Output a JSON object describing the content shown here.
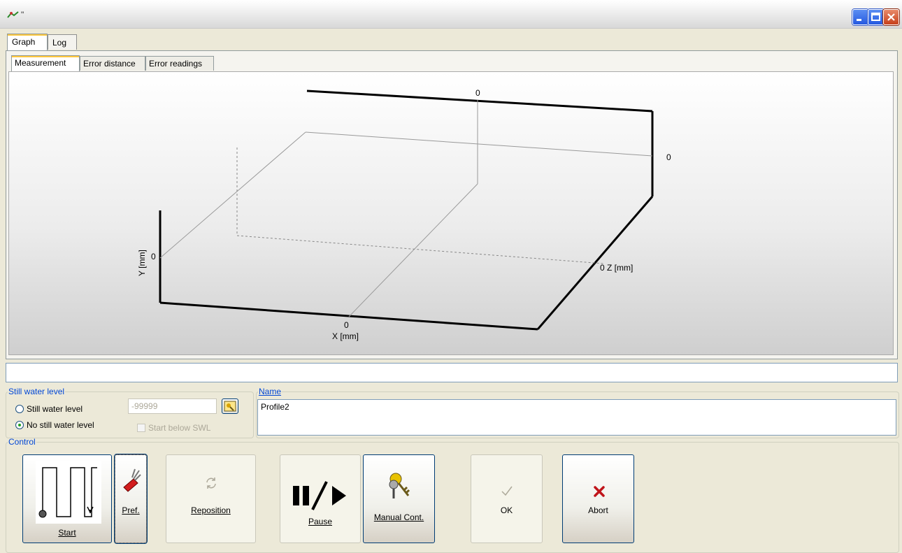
{
  "window": {
    "title": "\""
  },
  "outer_tabs": [
    "Graph",
    "Log"
  ],
  "inner_tabs": [
    "Measurement",
    "Error distance",
    "Error readings"
  ],
  "graph": {
    "x_label": "X [mm]",
    "y_label": "Y [mm]",
    "z_label": "Z [mm]",
    "x_tick": "0",
    "y_tick": "0",
    "z_tick": "0",
    "top_tick": "0",
    "right_tick": "0"
  },
  "still_water": {
    "legend": "Still water level",
    "option1": "Still water level",
    "option2": "No still water level",
    "selected": "No still water level",
    "value": "-99999",
    "checkbox_label": "Start below SWL"
  },
  "name": {
    "legend": "Name",
    "value": "Profile2"
  },
  "control": {
    "legend": "Control",
    "start": "Start",
    "pref": "Pref.",
    "reposition": "Reposition",
    "pause": "Pause",
    "manual": "Manual Cont.",
    "ok": "OK",
    "abort": "Abort"
  },
  "colors": {
    "legend_blue": "#0046d5",
    "abort_red": "#c0141a",
    "panel_bg": "#ece9d8"
  }
}
